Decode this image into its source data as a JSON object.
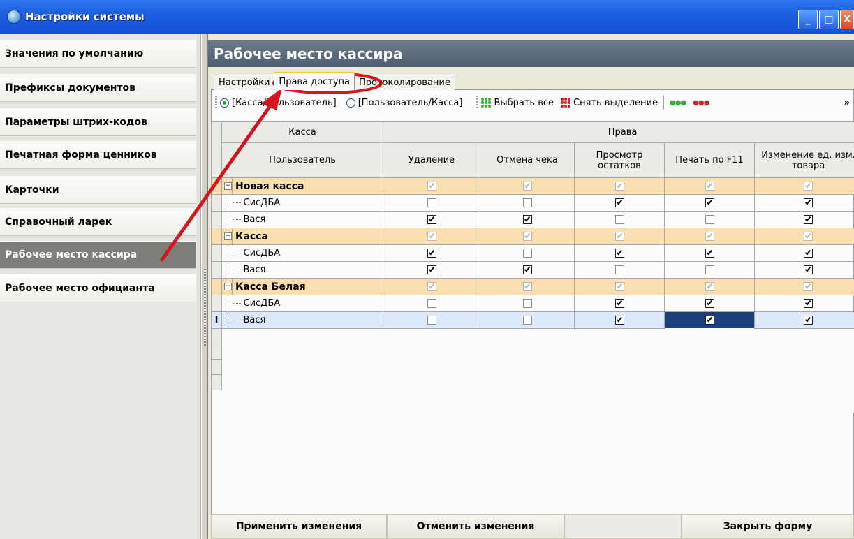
{
  "window": {
    "title": "Настройки системы",
    "buttons": {
      "minimize": "_",
      "maximize": "□",
      "close": "X"
    }
  },
  "sidebar": {
    "items": [
      {
        "label": "Значения по умолчанию",
        "active": false
      },
      {
        "label": "Префиксы документов",
        "active": false
      },
      {
        "label": "Параметры штрих-кодов",
        "active": false
      },
      {
        "label": "Печатная форма ценников",
        "active": false
      },
      {
        "label": "Карточки",
        "active": false
      },
      {
        "label": "Справочный ларек",
        "active": false
      },
      {
        "label": "Рабочее место кассира",
        "active": true
      },
      {
        "label": "Рабочее место официанта",
        "active": false
      }
    ]
  },
  "panel": {
    "title": "Рабочее место кассира",
    "tabs": [
      {
        "label": "Настройки",
        "active": false
      },
      {
        "label": "Права доступа",
        "active": true
      },
      {
        "label": "Протоколирование",
        "active": false
      }
    ]
  },
  "toolbar": {
    "radio_kassa_user": "[Касса/Пользователь]",
    "radio_user_kassa": "[Пользователь/Касса]",
    "select_all": "Выбрать все",
    "deselect": "Снять выделение",
    "more": "»"
  },
  "grid": {
    "header": {
      "kassa": "Касса",
      "user": "Пользователь",
      "rights": "Права",
      "columns": [
        "Удаление",
        "Отмена чека",
        "Просмотр остатков",
        "Печать по F11",
        "Изменение ед. изм. товара"
      ]
    },
    "rows": [
      {
        "type": "group",
        "name": "Новая касса",
        "checks": [
          true,
          true,
          true,
          true,
          true
        ]
      },
      {
        "type": "user",
        "name": "СисДБА",
        "checks": [
          false,
          false,
          true,
          true,
          true
        ]
      },
      {
        "type": "user",
        "name": "Вася",
        "checks": [
          true,
          true,
          false,
          false,
          true
        ]
      },
      {
        "type": "group",
        "name": "Касса",
        "checks": [
          true,
          true,
          true,
          true,
          true
        ]
      },
      {
        "type": "user",
        "name": "СисДБА",
        "checks": [
          true,
          false,
          true,
          true,
          true
        ]
      },
      {
        "type": "user",
        "name": "Вася",
        "checks": [
          true,
          true,
          false,
          false,
          true
        ]
      },
      {
        "type": "group",
        "name": "Касса Белая",
        "checks": [
          true,
          true,
          true,
          true,
          true
        ]
      },
      {
        "type": "user",
        "name": "СисДБА",
        "checks": [
          false,
          false,
          true,
          true,
          true
        ]
      },
      {
        "type": "user",
        "name": "Вася",
        "checks": [
          false,
          false,
          true,
          true,
          true
        ],
        "current": true,
        "focused_col": 3,
        "marker": "I"
      }
    ]
  },
  "buttons": {
    "apply": "Применить изменения",
    "cancel": "Отменить изменения",
    "close": "Закрыть форму"
  },
  "colors": {
    "title_bar": "#1c5fe0",
    "panel_header": "#5a6b7c",
    "group_row": "#f9dfb0",
    "current_row": "#dce8fb",
    "annotation_red": "#d4141e"
  }
}
